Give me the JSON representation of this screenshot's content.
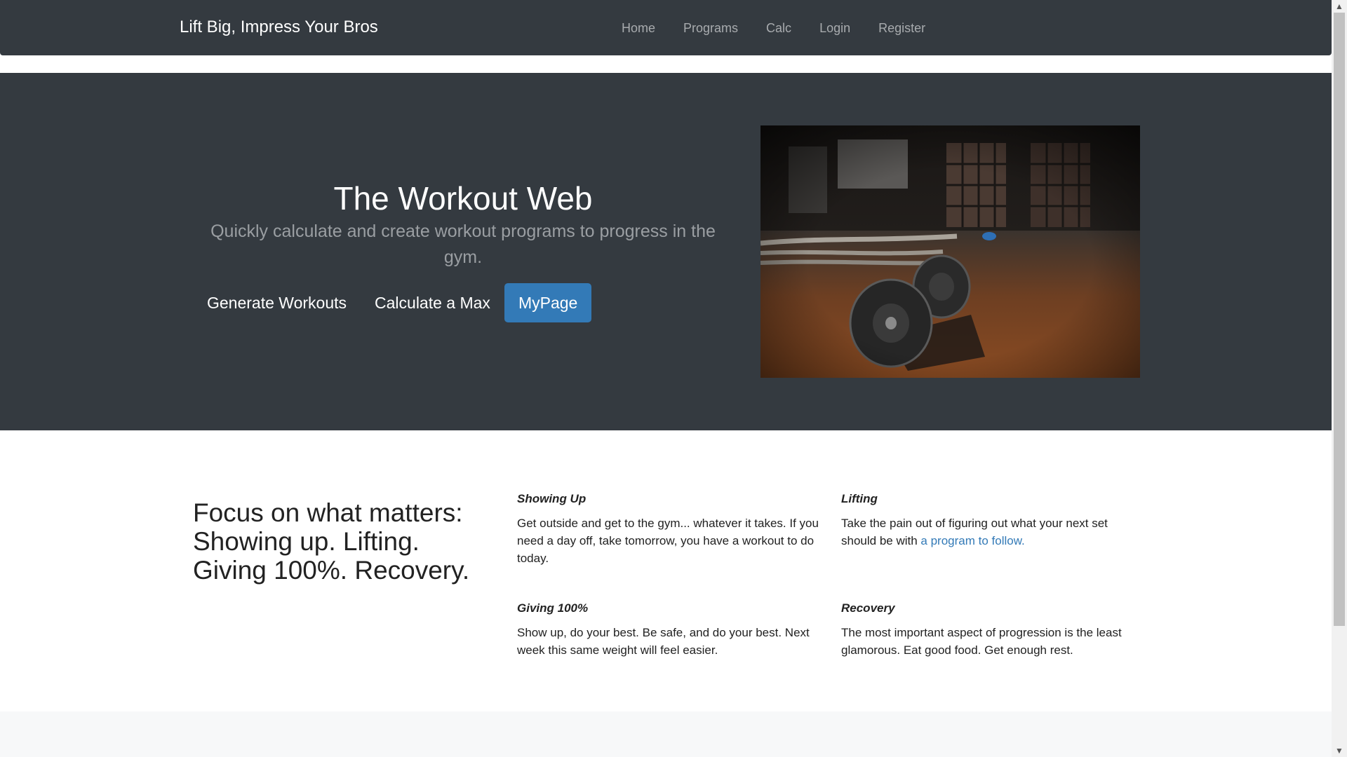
{
  "navbar": {
    "brand": "Lift Big, Impress Your Bros",
    "links": [
      "Home",
      "Programs",
      "Calc",
      "Login",
      "Register"
    ]
  },
  "hero": {
    "title": "The Workout Web",
    "subtitle": "Quickly calculate and create workout programs to progress in the gym.",
    "buttons": [
      "Generate Workouts",
      "Calculate a Max",
      "MyPage"
    ]
  },
  "features": {
    "heading": "Focus on what matters: Showing up. Lifting. Giving 100%. Recovery.",
    "items": [
      {
        "title": "Showing Up",
        "text": "Get outside and get to the gym... whatever it takes. If you need a day off, take tomorrow, you have a workout to do today."
      },
      {
        "title": "Lifting",
        "text_before": "Take the pain out of figuring out what your next set should be with ",
        "link": "a program to follow."
      },
      {
        "title": "Giving 100%",
        "text": "Show up, do your best. Be safe, and do your best. Next week this same weight will feel easier."
      },
      {
        "title": "Recovery",
        "text": "The most important aspect of progression is the least glamorous. Eat good food. Get enough rest."
      }
    ]
  },
  "icons": {
    "scroll_up": "▲",
    "scroll_down": "▼"
  },
  "colors": {
    "dark_bg": "#343a40",
    "primary": "#337ab7",
    "link": "#337ab7"
  }
}
